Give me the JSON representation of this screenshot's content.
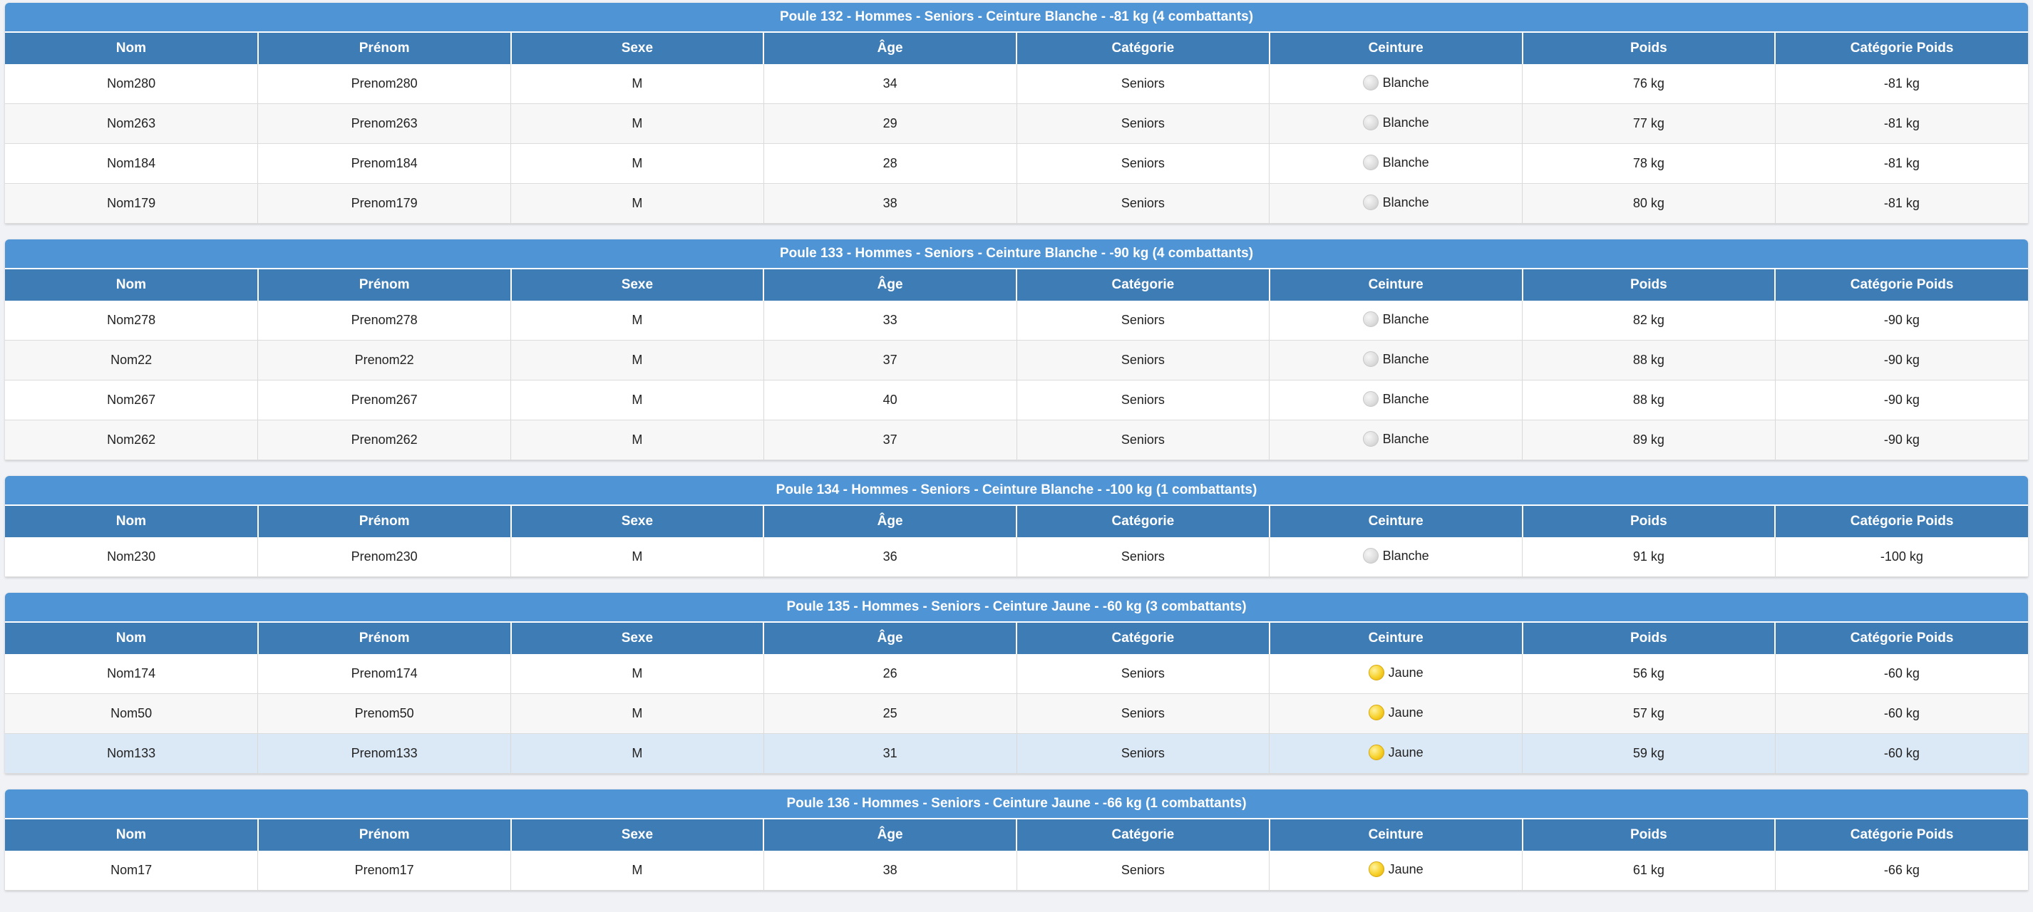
{
  "columns": [
    "Nom",
    "Prénom",
    "Sexe",
    "Âge",
    "Catégorie",
    "Ceinture",
    "Poids",
    "Catégorie Poids"
  ],
  "colors": {
    "title_bar": "#4f94d4",
    "header_bar": "#3e7cb6",
    "row_highlight": "#dbe8f6",
    "belt_blanche": "#dcdcdc",
    "belt_jaune": "#f7d12a"
  },
  "pools": [
    {
      "title": "Poule 132 - Hommes - Seniors - Ceinture Blanche - -81 kg (4 combattants)",
      "rows": [
        {
          "nom": "Nom280",
          "prenom": "Prenom280",
          "sexe": "M",
          "age": "34",
          "categorie": "Seniors",
          "belt_icon": "white-belt-icon",
          "ceinture": "Blanche",
          "poids": "76 kg",
          "cat_poids": "-81 kg"
        },
        {
          "nom": "Nom263",
          "prenom": "Prenom263",
          "sexe": "M",
          "age": "29",
          "categorie": "Seniors",
          "belt_icon": "white-belt-icon",
          "ceinture": "Blanche",
          "poids": "77 kg",
          "cat_poids": "-81 kg"
        },
        {
          "nom": "Nom184",
          "prenom": "Prenom184",
          "sexe": "M",
          "age": "28",
          "categorie": "Seniors",
          "belt_icon": "white-belt-icon",
          "ceinture": "Blanche",
          "poids": "78 kg",
          "cat_poids": "-81 kg"
        },
        {
          "nom": "Nom179",
          "prenom": "Prenom179",
          "sexe": "M",
          "age": "38",
          "categorie": "Seniors",
          "belt_icon": "white-belt-icon",
          "ceinture": "Blanche",
          "poids": "80 kg",
          "cat_poids": "-81 kg"
        }
      ]
    },
    {
      "title": "Poule 133 - Hommes - Seniors - Ceinture Blanche - -90 kg (4 combattants)",
      "rows": [
        {
          "nom": "Nom278",
          "prenom": "Prenom278",
          "sexe": "M",
          "age": "33",
          "categorie": "Seniors",
          "belt_icon": "white-belt-icon",
          "ceinture": "Blanche",
          "poids": "82 kg",
          "cat_poids": "-90 kg"
        },
        {
          "nom": "Nom22",
          "prenom": "Prenom22",
          "sexe": "M",
          "age": "37",
          "categorie": "Seniors",
          "belt_icon": "white-belt-icon",
          "ceinture": "Blanche",
          "poids": "88 kg",
          "cat_poids": "-90 kg"
        },
        {
          "nom": "Nom267",
          "prenom": "Prenom267",
          "sexe": "M",
          "age": "40",
          "categorie": "Seniors",
          "belt_icon": "white-belt-icon",
          "ceinture": "Blanche",
          "poids": "88 kg",
          "cat_poids": "-90 kg"
        },
        {
          "nom": "Nom262",
          "prenom": "Prenom262",
          "sexe": "M",
          "age": "37",
          "categorie": "Seniors",
          "belt_icon": "white-belt-icon",
          "ceinture": "Blanche",
          "poids": "89 kg",
          "cat_poids": "-90 kg"
        }
      ]
    },
    {
      "title": "Poule 134 - Hommes - Seniors - Ceinture Blanche - -100 kg (1 combattants)",
      "rows": [
        {
          "nom": "Nom230",
          "prenom": "Prenom230",
          "sexe": "M",
          "age": "36",
          "categorie": "Seniors",
          "belt_icon": "white-belt-icon",
          "ceinture": "Blanche",
          "poids": "91 kg",
          "cat_poids": "-100 kg"
        }
      ]
    },
    {
      "title": "Poule 135 - Hommes - Seniors - Ceinture Jaune - -60 kg (3 combattants)",
      "rows": [
        {
          "nom": "Nom174",
          "prenom": "Prenom174",
          "sexe": "M",
          "age": "26",
          "categorie": "Seniors",
          "belt_icon": "yellow-belt-icon",
          "ceinture": "Jaune",
          "poids": "56 kg",
          "cat_poids": "-60 kg"
        },
        {
          "nom": "Nom50",
          "prenom": "Prenom50",
          "sexe": "M",
          "age": "25",
          "categorie": "Seniors",
          "belt_icon": "yellow-belt-icon",
          "ceinture": "Jaune",
          "poids": "57 kg",
          "cat_poids": "-60 kg"
        },
        {
          "nom": "Nom133",
          "prenom": "Prenom133",
          "sexe": "M",
          "age": "31",
          "categorie": "Seniors",
          "belt_icon": "yellow-belt-icon",
          "ceinture": "Jaune",
          "poids": "59 kg",
          "cat_poids": "-60 kg",
          "highlighted": true
        }
      ]
    },
    {
      "title": "Poule 136 - Hommes - Seniors - Ceinture Jaune - -66 kg (1 combattants)",
      "rows": [
        {
          "nom": "Nom17",
          "prenom": "Prenom17",
          "sexe": "M",
          "age": "38",
          "categorie": "Seniors",
          "belt_icon": "yellow-belt-icon",
          "ceinture": "Jaune",
          "poids": "61 kg",
          "cat_poids": "-66 kg"
        }
      ]
    }
  ]
}
